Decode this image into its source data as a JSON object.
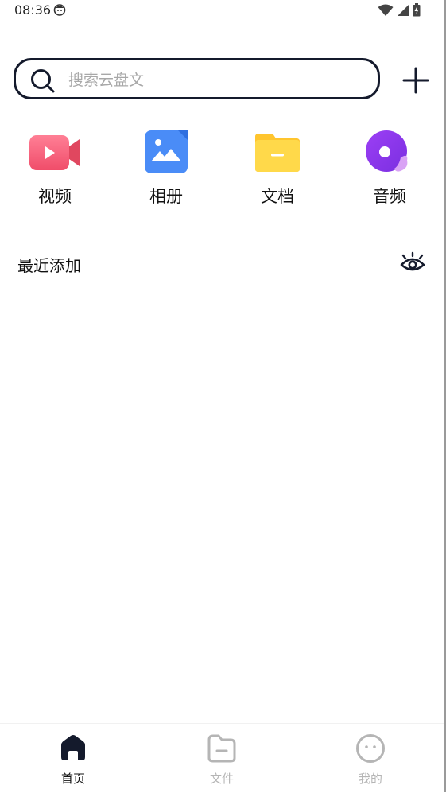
{
  "status_bar": {
    "time": "08:36"
  },
  "search": {
    "placeholder": "搜索云盘文"
  },
  "categories": [
    {
      "label": "视频",
      "icon": "video-icon",
      "color": "#f0506e"
    },
    {
      "label": "相册",
      "icon": "image-icon",
      "color": "#4a8cf7"
    },
    {
      "label": "文档",
      "icon": "folder-icon",
      "color": "#ffd23f"
    },
    {
      "label": "音频",
      "icon": "music-icon",
      "color": "#8a3cf0"
    }
  ],
  "recent": {
    "title": "最近添加"
  },
  "bottom_nav": {
    "items": [
      {
        "label": "首页",
        "icon": "home-icon",
        "active": true
      },
      {
        "label": "文件",
        "icon": "folder-outline-icon",
        "active": false
      },
      {
        "label": "我的",
        "icon": "smiley-face-icon",
        "active": false
      }
    ]
  },
  "colors": {
    "accent": "#141a2c",
    "inactive": "#b5b5b5"
  }
}
